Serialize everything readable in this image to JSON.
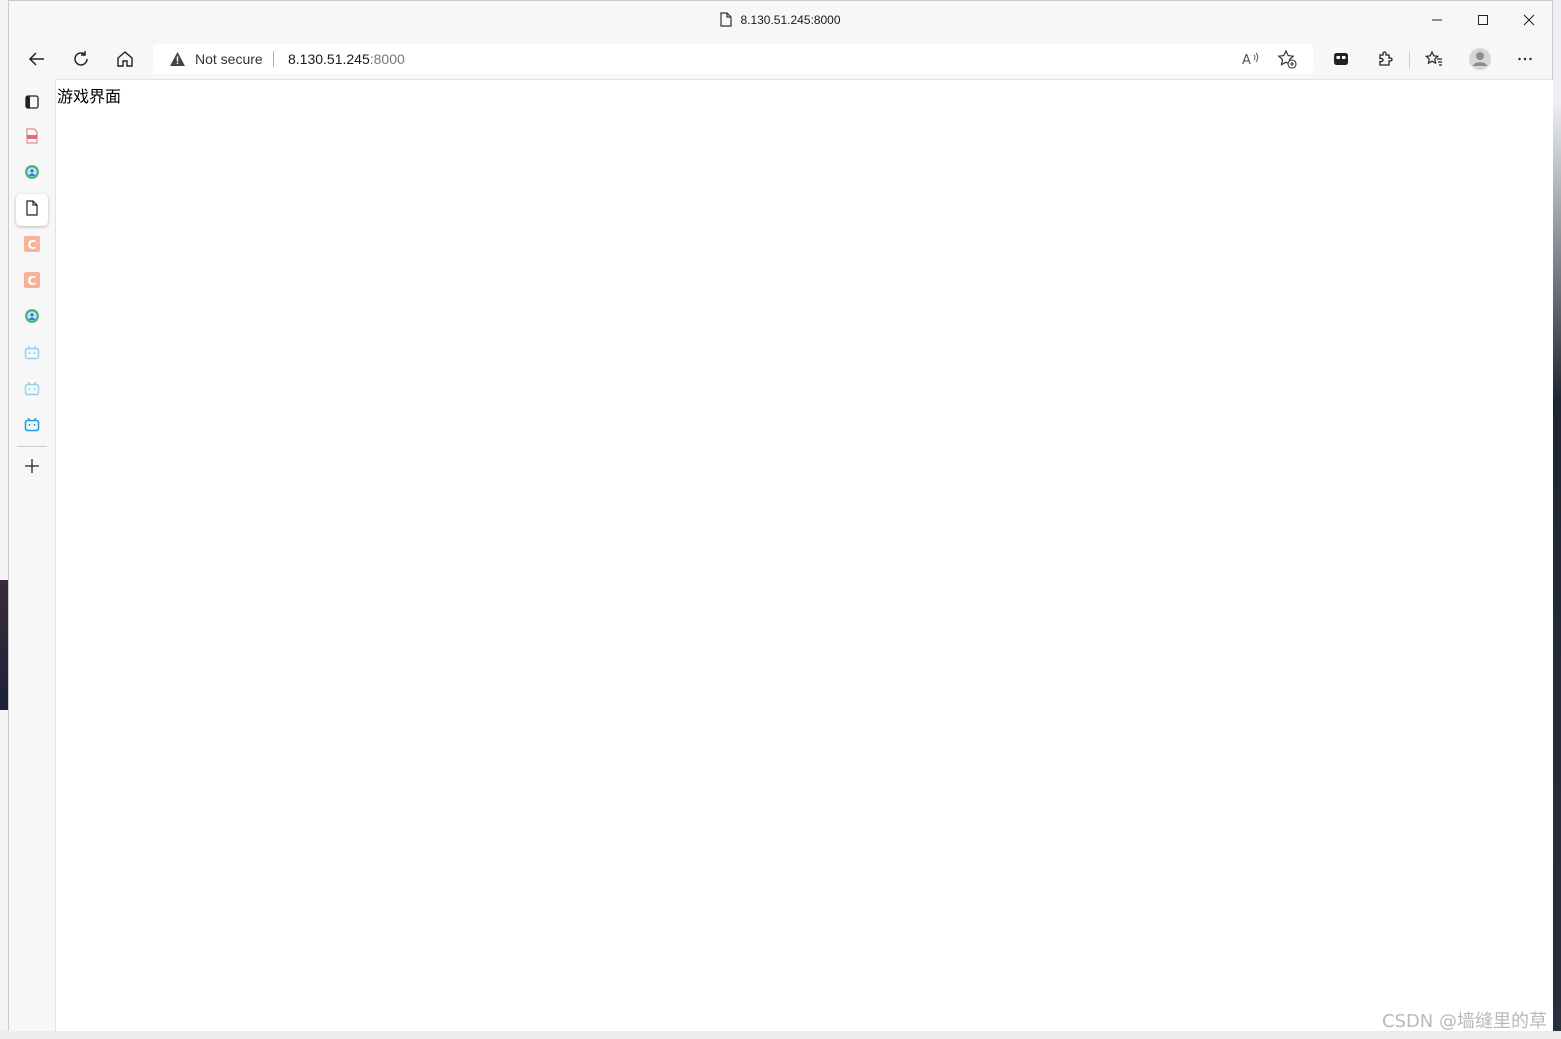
{
  "window": {
    "title": "8.130.51.245:8000"
  },
  "toolbar": {
    "security_label": "Not secure",
    "url_host": "8.130.51.245",
    "url_port": ":8000"
  },
  "sidebar": {
    "tabs": [
      {
        "icon": "tab-actions-icon"
      },
      {
        "icon": "pdf-file-icon"
      },
      {
        "icon": "green-globe-icon"
      },
      {
        "icon": "blank-page-icon",
        "active": true
      },
      {
        "icon": "csdn-c-icon"
      },
      {
        "icon": "csdn-c-icon"
      },
      {
        "icon": "green-globe-icon"
      },
      {
        "icon": "bilibili-icon"
      },
      {
        "icon": "bilibili-icon"
      },
      {
        "icon": "bilibili-icon"
      }
    ]
  },
  "page": {
    "body_text": "游戏界面"
  },
  "watermark": {
    "text": "CSDN @墙缝里的草"
  },
  "colors": {
    "csdn": "#f7b39a",
    "bilibili": "#4fb8e6",
    "green_globe": "#52b788"
  }
}
